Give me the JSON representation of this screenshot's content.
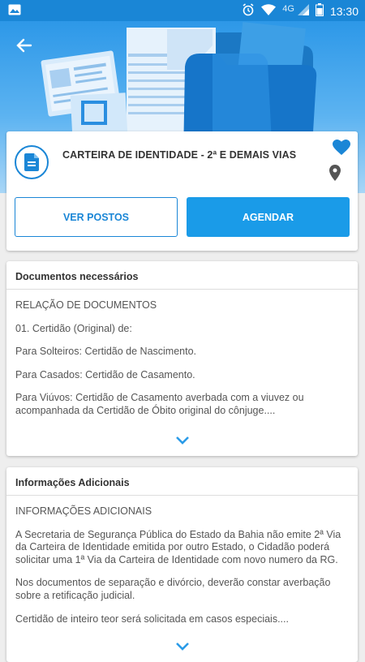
{
  "status_bar": {
    "network": "4G",
    "time": "13:30"
  },
  "service": {
    "title": "CARTEIRA DE IDENTIDADE - 2ª E DEMAIS VIAS",
    "btn_ver_postos": "VER POSTOS",
    "btn_agendar": "AGENDAR"
  },
  "documentos": {
    "heading": "Documentos necessários",
    "lines": [
      "RELAÇÃO DE DOCUMENTOS",
      "01. Certidão (Original) de:",
      "Para Solteiros: Certidão de Nascimento.",
      "Para Casados: Certidão de Casamento.",
      "Para Viúvos: Certidão de Casamento averbada com a viuvez ou acompanhada da Certidão de Óbito original do cônjuge...."
    ]
  },
  "informacoes": {
    "heading": "Informações Adicionais",
    "lines": [
      "INFORMAÇÕES ADICIONAIS",
      "A Secretaria de Segurança Pública do Estado da Bahia não emite 2ª Via da Carteira de Identidade emitida por outro Estado, o Cidadão poderá solicitar uma 1ª Via da Carteira de Identidade com novo numero da RG.",
      "Nos documentos de separação e divórcio, deverão constar averbação sobre a retificação judicial.",
      "Certidão de inteiro teor será solicitada em casos especiais...."
    ]
  },
  "colors": {
    "primary": "#1a86d6",
    "button": "#1a9be8"
  }
}
